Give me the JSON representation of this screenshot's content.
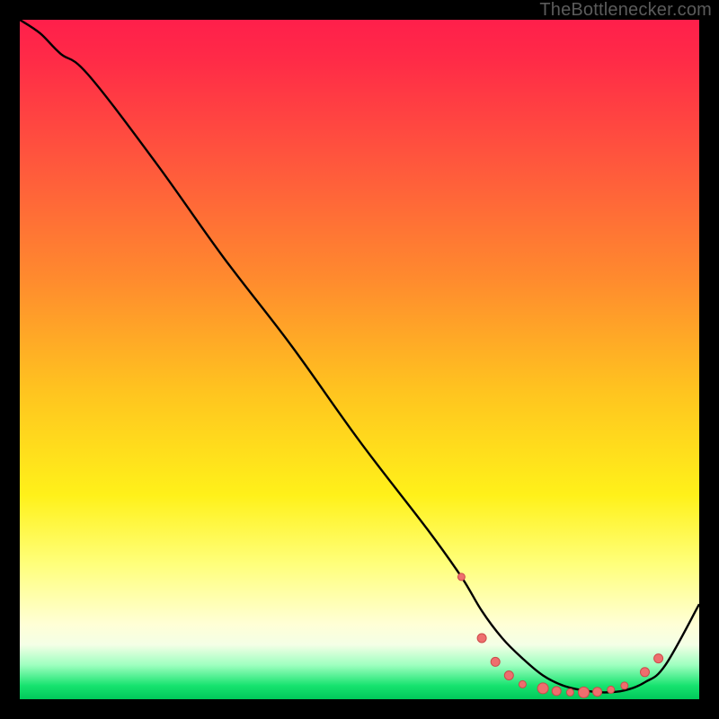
{
  "watermark": "TheBottlenecker.com",
  "colors": {
    "curve": "#000000",
    "dot_fill": "#ee6e6e",
    "dot_stroke": "#cc4a4a",
    "gradient_top": "#ff1f4b",
    "gradient_bottom": "#00c95a"
  },
  "chart_data": {
    "type": "line",
    "title": "",
    "xlabel": "",
    "ylabel": "",
    "xlim": [
      0,
      100
    ],
    "ylim": [
      0,
      100
    ],
    "series": [
      {
        "name": "bottleneck-curve",
        "x": [
          0,
          3,
          6,
          10,
          20,
          30,
          40,
          50,
          60,
          65,
          68,
          71,
          74,
          77,
          80,
          83,
          86,
          89,
          92,
          95,
          100
        ],
        "y": [
          100,
          98,
          95,
          92,
          79,
          65,
          52,
          38,
          25,
          18,
          13,
          9,
          6,
          3.5,
          2,
          1.3,
          1,
          1.3,
          2.5,
          5,
          14
        ]
      }
    ],
    "dots": {
      "name": "highlighted-points",
      "points": [
        {
          "x": 65,
          "y": 18,
          "r": 4
        },
        {
          "x": 68,
          "y": 9,
          "r": 5
        },
        {
          "x": 70,
          "y": 5.5,
          "r": 5
        },
        {
          "x": 72,
          "y": 3.5,
          "r": 5
        },
        {
          "x": 74,
          "y": 2.2,
          "r": 4
        },
        {
          "x": 77,
          "y": 1.6,
          "r": 6
        },
        {
          "x": 79,
          "y": 1.2,
          "r": 5
        },
        {
          "x": 81,
          "y": 1.0,
          "r": 4
        },
        {
          "x": 83,
          "y": 1.0,
          "r": 6
        },
        {
          "x": 85,
          "y": 1.1,
          "r": 5
        },
        {
          "x": 87,
          "y": 1.4,
          "r": 4
        },
        {
          "x": 89,
          "y": 2.0,
          "r": 4
        },
        {
          "x": 92,
          "y": 4.0,
          "r": 5
        },
        {
          "x": 94,
          "y": 6.0,
          "r": 5
        }
      ]
    }
  }
}
